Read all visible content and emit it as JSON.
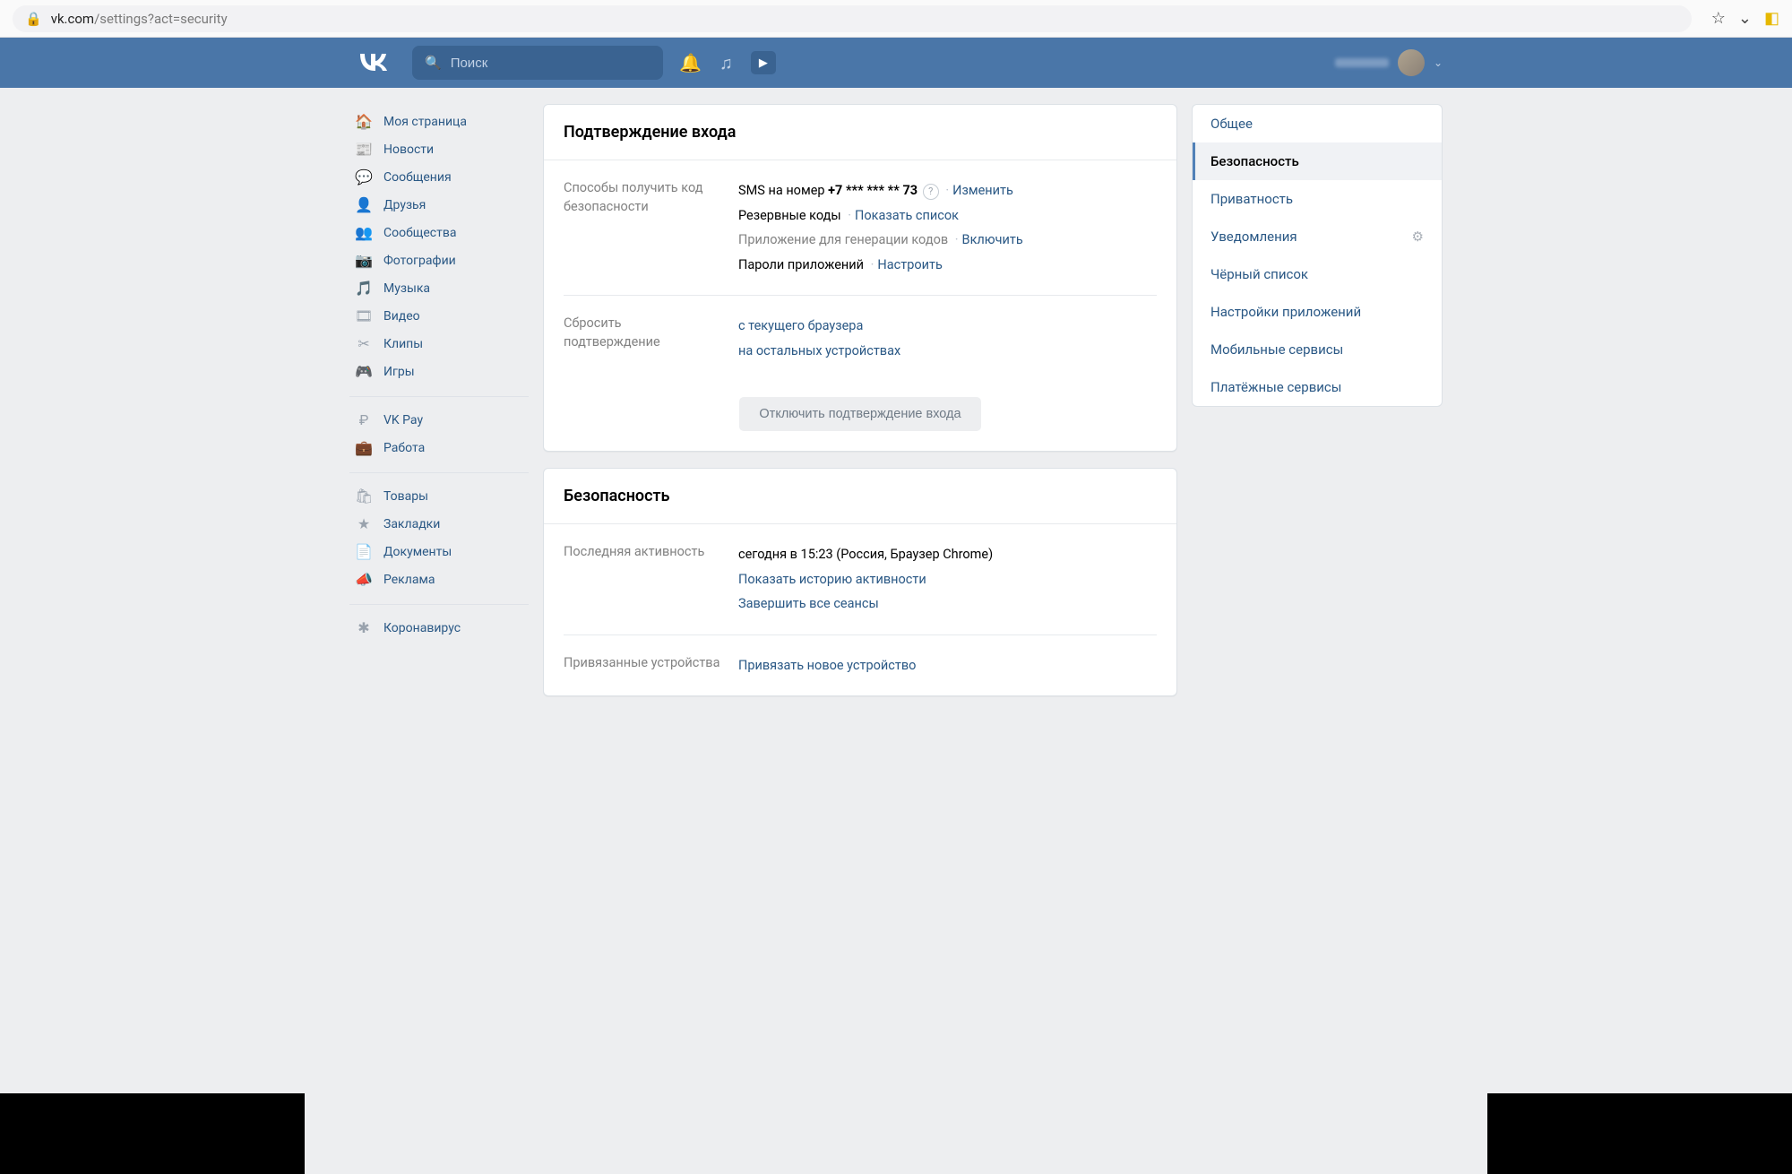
{
  "browser": {
    "url_host": "vk.com",
    "url_path": "/settings?act=security"
  },
  "header": {
    "search_placeholder": "Поиск"
  },
  "left_nav": {
    "groups": [
      [
        {
          "icon": "🏠",
          "label": "Моя страница"
        },
        {
          "icon": "📰",
          "label": "Новости"
        },
        {
          "icon": "💬",
          "label": "Сообщения"
        },
        {
          "icon": "👤",
          "label": "Друзья"
        },
        {
          "icon": "👥",
          "label": "Сообщества"
        },
        {
          "icon": "📷",
          "label": "Фотографии"
        },
        {
          "icon": "🎵",
          "label": "Музыка"
        },
        {
          "icon": "🎞",
          "label": "Видео"
        },
        {
          "icon": "✂",
          "label": "Клипы"
        },
        {
          "icon": "🎮",
          "label": "Игры"
        }
      ],
      [
        {
          "icon": "₽",
          "label": "VK Pay"
        },
        {
          "icon": "💼",
          "label": "Работа"
        }
      ],
      [
        {
          "icon": "🛍",
          "label": "Товары"
        },
        {
          "icon": "★",
          "label": "Закладки"
        },
        {
          "icon": "📄",
          "label": "Документы"
        },
        {
          "icon": "📣",
          "label": "Реклама"
        }
      ],
      [
        {
          "icon": "✱",
          "label": "Коронавирус"
        }
      ]
    ]
  },
  "panel1": {
    "title": "Подтверждение входа",
    "r1_label": "Способы получить код безопасности",
    "r1": {
      "sms_prefix": "SMS на номер ",
      "sms_number": "+7 *** *** ** 73",
      "sms_action": "Изменить",
      "backup_label": "Резервные коды",
      "backup_action": "Показать список",
      "app_label": "Приложение для генерации кодов",
      "app_action": "Включить",
      "pw_label": "Пароли приложений",
      "pw_action": "Настроить"
    },
    "r2_label": "Сбросить подтверждение",
    "r2": {
      "link1": "с текущего браузера",
      "link2": "на остальных устройствах"
    },
    "disable_btn": "Отключить подтверждение входа"
  },
  "panel2": {
    "title": "Безопасность",
    "r1_label": "Последняя активность",
    "r1": {
      "text": "сегодня в 15:23 (Россия, Браузер Chrome)",
      "link1": "Показать историю активности",
      "link2": "Завершить все сеансы"
    },
    "r2_label": "Привязанные устройства",
    "r2_link": "Привязать новое устройство"
  },
  "right_tabs": [
    {
      "label": "Общее",
      "active": false,
      "gear": false
    },
    {
      "label": "Безопасность",
      "active": true,
      "gear": false
    },
    {
      "label": "Приватность",
      "active": false,
      "gear": false
    },
    {
      "label": "Уведомления",
      "active": false,
      "gear": true
    },
    {
      "label": "Чёрный список",
      "active": false,
      "gear": false
    },
    {
      "label": "Настройки приложений",
      "active": false,
      "gear": false
    },
    {
      "label": "Мобильные сервисы",
      "active": false,
      "gear": false
    },
    {
      "label": "Платёжные сервисы",
      "active": false,
      "gear": false
    }
  ]
}
